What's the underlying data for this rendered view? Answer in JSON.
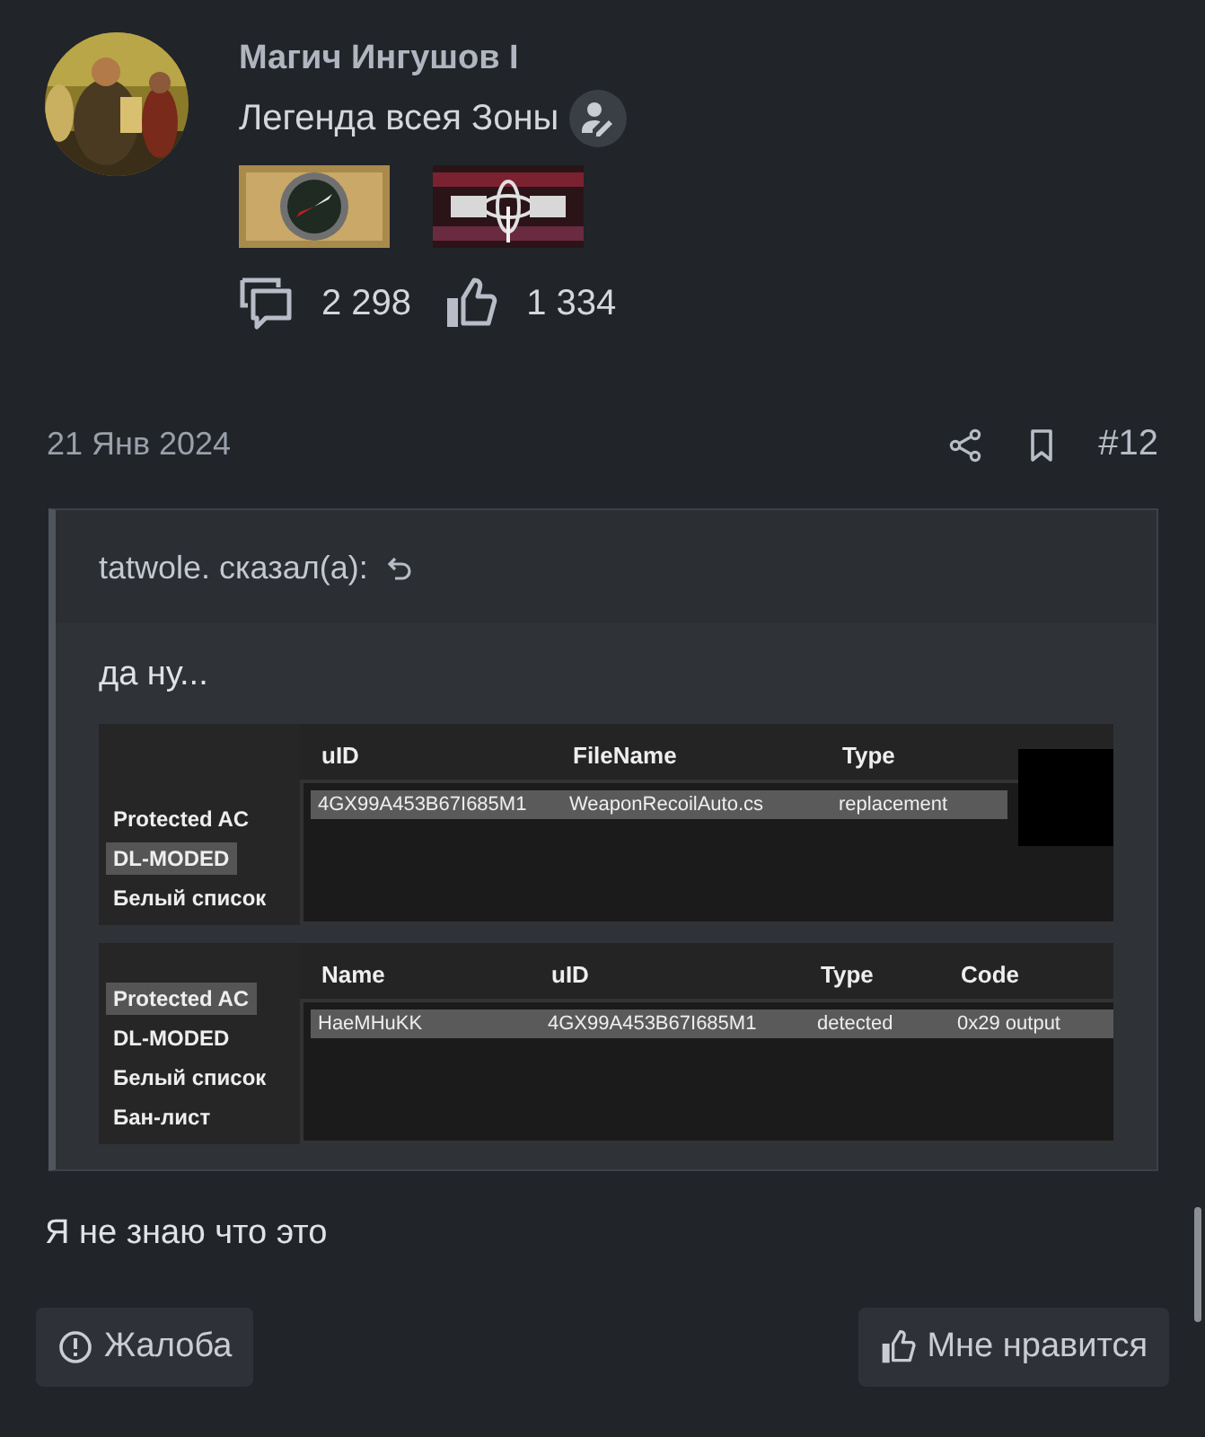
{
  "author": {
    "name": "Магич Ингушов I",
    "title": "Легенда всея Зоны"
  },
  "stats": {
    "messages": "2 298",
    "reactions": "1 334"
  },
  "post": {
    "date": "21 Янв 2024",
    "number": "#12"
  },
  "quote": {
    "header": "tatwole. сказал(а):",
    "text": "да ну...",
    "panels": [
      {
        "sidebar": [
          {
            "label": "Protected AC",
            "selected": false
          },
          {
            "label": "DL-MODED",
            "selected": true
          },
          {
            "label": "Белый список",
            "selected": false
          }
        ],
        "columns": [
          "uID",
          "FileName",
          "Type"
        ],
        "rows": [
          [
            "4GX99A453B67I685M1",
            "WeaponRecoilAuto.cs",
            "replacement"
          ]
        ],
        "redacted": true
      },
      {
        "sidebar": [
          {
            "label": "Protected AC",
            "selected": true
          },
          {
            "label": "DL-MODED",
            "selected": false
          },
          {
            "label": "Белый список",
            "selected": false
          },
          {
            "label": "Бан-лист",
            "selected": false
          }
        ],
        "columns": [
          "Name",
          "uID",
          "Type",
          "Code"
        ],
        "rows": [
          [
            "HaeMHuKK",
            "4GX99A453B67I685M1",
            "detected",
            "0x29 output"
          ]
        ],
        "redacted": false
      }
    ]
  },
  "body": "Я не знаю что это",
  "buttons": {
    "report": "Жалоба",
    "like": "Мне нравится"
  }
}
